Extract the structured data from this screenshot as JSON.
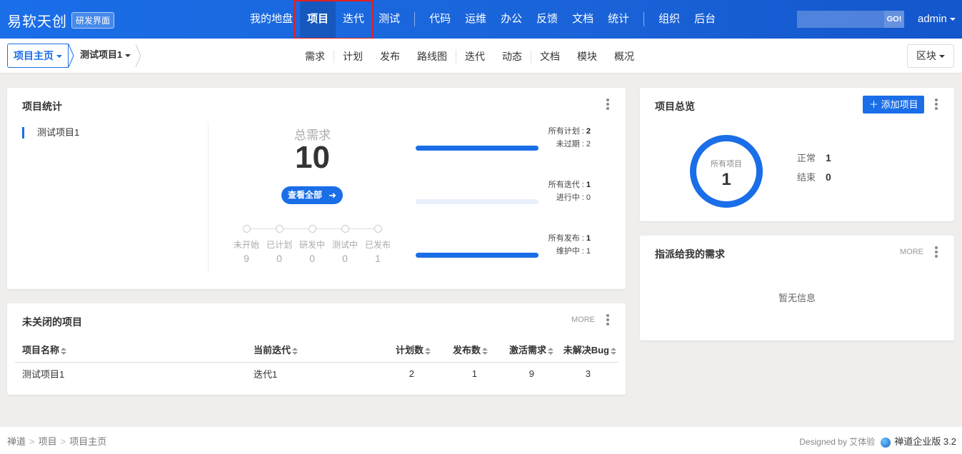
{
  "topbar": {
    "brand": "易软天创",
    "badge": "研发界面",
    "nav": [
      {
        "label": "我的地盘"
      },
      {
        "label": "项目"
      },
      {
        "label": "迭代"
      },
      {
        "label": "测试"
      },
      {
        "label": "代码"
      },
      {
        "label": "运维"
      },
      {
        "label": "办公"
      },
      {
        "label": "反馈"
      },
      {
        "label": "文档"
      },
      {
        "label": "统计"
      },
      {
        "label": "组织"
      },
      {
        "label": "后台"
      }
    ],
    "search_value": "",
    "go_label": "GO!",
    "user": "admin"
  },
  "subbar": {
    "crumb_home": "项目主页",
    "crumb_project": "测试项目1",
    "nav": [
      {
        "label": "需求"
      },
      {
        "label": "计划"
      },
      {
        "label": "发布"
      },
      {
        "label": "路线图"
      },
      {
        "label": "迭代"
      },
      {
        "label": "动态"
      },
      {
        "label": "文档"
      },
      {
        "label": "模块"
      },
      {
        "label": "概况"
      }
    ],
    "block_label": "区块"
  },
  "stats": {
    "title": "项目统计",
    "project_item": "测试项目1",
    "total_label": "总需求",
    "total_value": "10",
    "view_all": "查看全部",
    "stages": [
      {
        "label": "未开始",
        "value": "9"
      },
      {
        "label": "已计划",
        "value": "0"
      },
      {
        "label": "研发中",
        "value": "0"
      },
      {
        "label": "测试中",
        "value": "0"
      },
      {
        "label": "已发布",
        "value": "1"
      }
    ],
    "bars": [
      {
        "line1_label": "所有计划 : ",
        "line1_value": "2",
        "line2": "未过期 : 2",
        "fill": 1.0
      },
      {
        "line1_label": "所有迭代 : ",
        "line1_value": "1",
        "line2": "进行中 : 0",
        "fill": 0.0
      },
      {
        "line1_label": "所有发布 : ",
        "line1_value": "1",
        "line2": "维护中 : 1",
        "fill": 1.0
      }
    ]
  },
  "unclosed": {
    "title": "未关闭的项目",
    "more": "MORE",
    "columns": [
      "项目名称",
      "当前迭代",
      "计划数",
      "发布数",
      "激活需求",
      "未解决Bug"
    ],
    "rows": [
      {
        "name": "测试项目1",
        "execution": "迭代1",
        "plans": "2",
        "releases": "1",
        "stories": "9",
        "bugs": "3"
      }
    ]
  },
  "overview": {
    "title": "项目总览",
    "add_label": "添加项目",
    "donut_label": "所有项目",
    "donut_value": "1",
    "normal_label": "正常",
    "normal_value": "1",
    "closed_label": "结束",
    "closed_value": "0"
  },
  "assigned": {
    "title": "指派给我的需求",
    "more": "MORE",
    "empty": "暂无信息"
  },
  "footer": {
    "crumbs": [
      "禅道",
      "项目",
      "项目主页"
    ],
    "designed_by": "Designed by 艾体验",
    "product": "禅道企业版 3.2"
  },
  "colors": {
    "primary": "#1a6ee8",
    "highlight_border": "#e02020"
  }
}
